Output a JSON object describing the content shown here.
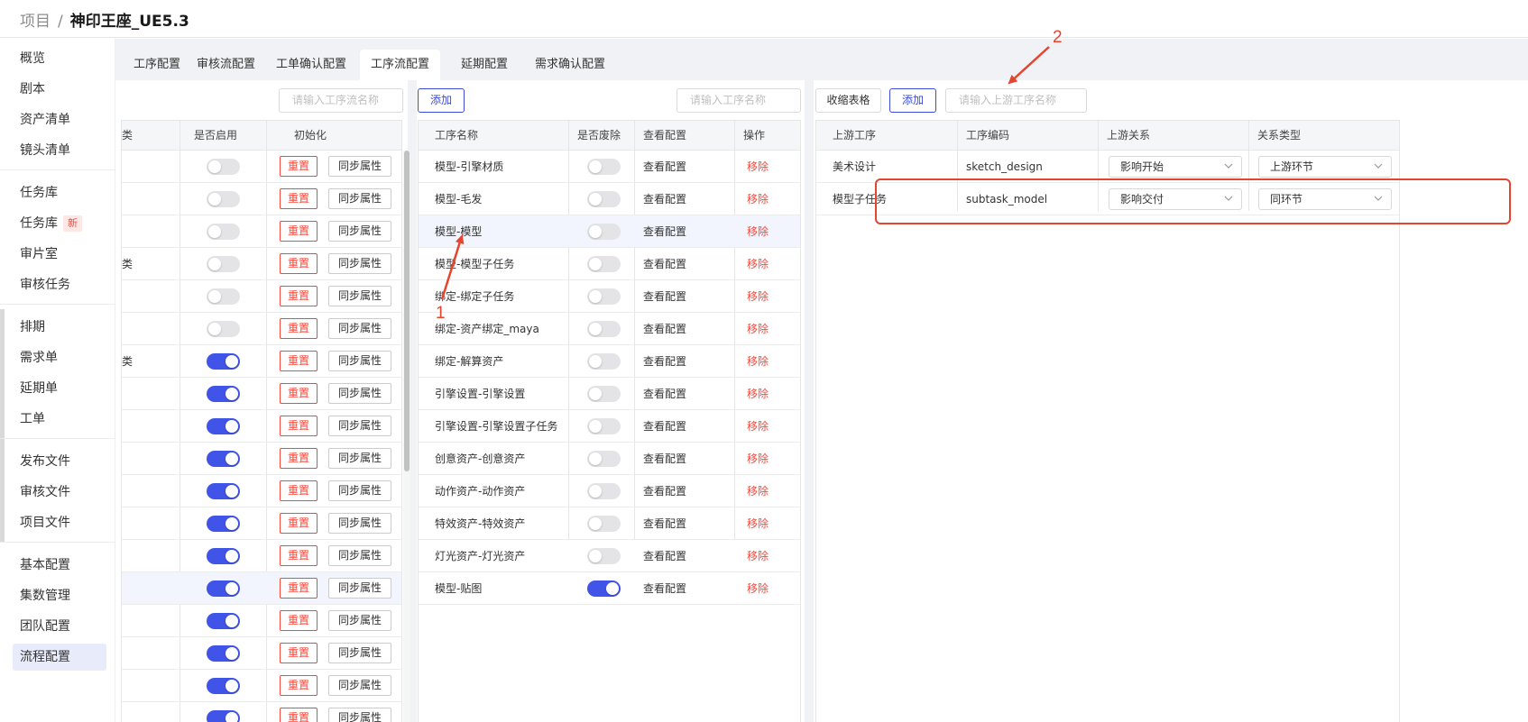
{
  "header": {
    "breadcrumb_root": "项目",
    "separator": "/",
    "project_name": "神印王座_UE5.3"
  },
  "sidebar": {
    "items": [
      {
        "label": "概览"
      },
      {
        "label": "剧本"
      },
      {
        "label": "资产清单"
      },
      {
        "label": "镜头清单"
      },
      {
        "label": "任务库"
      },
      {
        "label": "任务库",
        "badge": "新"
      },
      {
        "label": "审片室"
      },
      {
        "label": "审核任务"
      },
      {
        "label": "排期"
      },
      {
        "label": "需求单"
      },
      {
        "label": "延期单"
      },
      {
        "label": "工单"
      },
      {
        "label": "发布文件"
      },
      {
        "label": "审核文件"
      },
      {
        "label": "项目文件"
      },
      {
        "label": "基本配置"
      },
      {
        "label": "集数管理"
      },
      {
        "label": "团队配置"
      },
      {
        "label": "流程配置",
        "active": true
      }
    ]
  },
  "tabs": [
    {
      "label": "工序配置"
    },
    {
      "label": "审核流配置"
    },
    {
      "label": "工单确认配置"
    },
    {
      "label": "工序流配置",
      "active": true
    },
    {
      "label": "延期配置"
    },
    {
      "label": "需求确认配置"
    }
  ],
  "left_panel": {
    "search_placeholder": "请输入工序流名称",
    "add_label": "添加",
    "columns": {
      "category": "类",
      "enabled": "是否启用",
      "init": "初始化"
    },
    "reset_label": "重置",
    "sync_label": "同步属性",
    "rows": [
      {
        "category": "",
        "enabled": false
      },
      {
        "category": "",
        "enabled": false
      },
      {
        "category": "",
        "enabled": false
      },
      {
        "category": "类",
        "enabled": false
      },
      {
        "category": "",
        "enabled": false
      },
      {
        "category": "",
        "enabled": false
      },
      {
        "category": "类",
        "enabled": true
      },
      {
        "category": "",
        "enabled": true
      },
      {
        "category": "",
        "enabled": true
      },
      {
        "category": "",
        "enabled": true
      },
      {
        "category": "",
        "enabled": true
      },
      {
        "category": "",
        "enabled": true
      },
      {
        "category": "",
        "enabled": true
      },
      {
        "category": "",
        "enabled": true,
        "highlight": true
      },
      {
        "category": "",
        "enabled": true
      },
      {
        "category": "",
        "enabled": true
      },
      {
        "category": "",
        "enabled": true
      },
      {
        "category": "",
        "enabled": true
      }
    ]
  },
  "middle_panel": {
    "search_placeholder": "请输入工序名称",
    "columns": {
      "name": "工序名称",
      "deprecated": "是否废除",
      "view": "查看配置",
      "action": "操作"
    },
    "view_label": "查看配置",
    "remove_label": "移除",
    "rows": [
      {
        "name": "模型-引擎材质",
        "deprecated": false
      },
      {
        "name": "模型-毛发",
        "deprecated": false
      },
      {
        "name": "模型-模型",
        "deprecated": false,
        "highlight": true
      },
      {
        "name": "模型-模型子任务",
        "deprecated": false
      },
      {
        "name": "绑定-绑定子任务",
        "deprecated": false
      },
      {
        "name": "绑定-资产绑定_maya",
        "deprecated": false
      },
      {
        "name": "绑定-解算资产",
        "deprecated": false
      },
      {
        "name": "引擎设置-引擎设置",
        "deprecated": false
      },
      {
        "name": "引擎设置-引擎设置子任务",
        "deprecated": false
      },
      {
        "name": "创意资产-创意资产",
        "deprecated": false
      },
      {
        "name": "动作资产-动作资产",
        "deprecated": false
      },
      {
        "name": "特效资产-特效资产",
        "deprecated": false
      },
      {
        "name": "灯光资产-灯光资产",
        "deprecated": false
      },
      {
        "name": "模型-贴图",
        "deprecated": true
      }
    ]
  },
  "right_panel": {
    "collapse_label": "收缩表格",
    "add_label": "添加",
    "search_placeholder": "请输入上游工序名称",
    "columns": {
      "upstream": "上游工序",
      "code": "工序编码",
      "relation": "上游关系",
      "type": "关系类型"
    },
    "rows": [
      {
        "upstream": "美术设计",
        "code": "sketch_design",
        "relation": "影响开始",
        "type": "上游环节"
      },
      {
        "upstream": "模型子任务",
        "code": "subtask_model",
        "relation": "影响交付",
        "type": "同环节"
      }
    ]
  },
  "annotations": {
    "label_1": "1",
    "label_2": "2",
    "color": "#e5452f"
  },
  "colors": {
    "accent": "#3c4bd9",
    "switch_on": "#4154e8",
    "danger": "#f5483b"
  }
}
